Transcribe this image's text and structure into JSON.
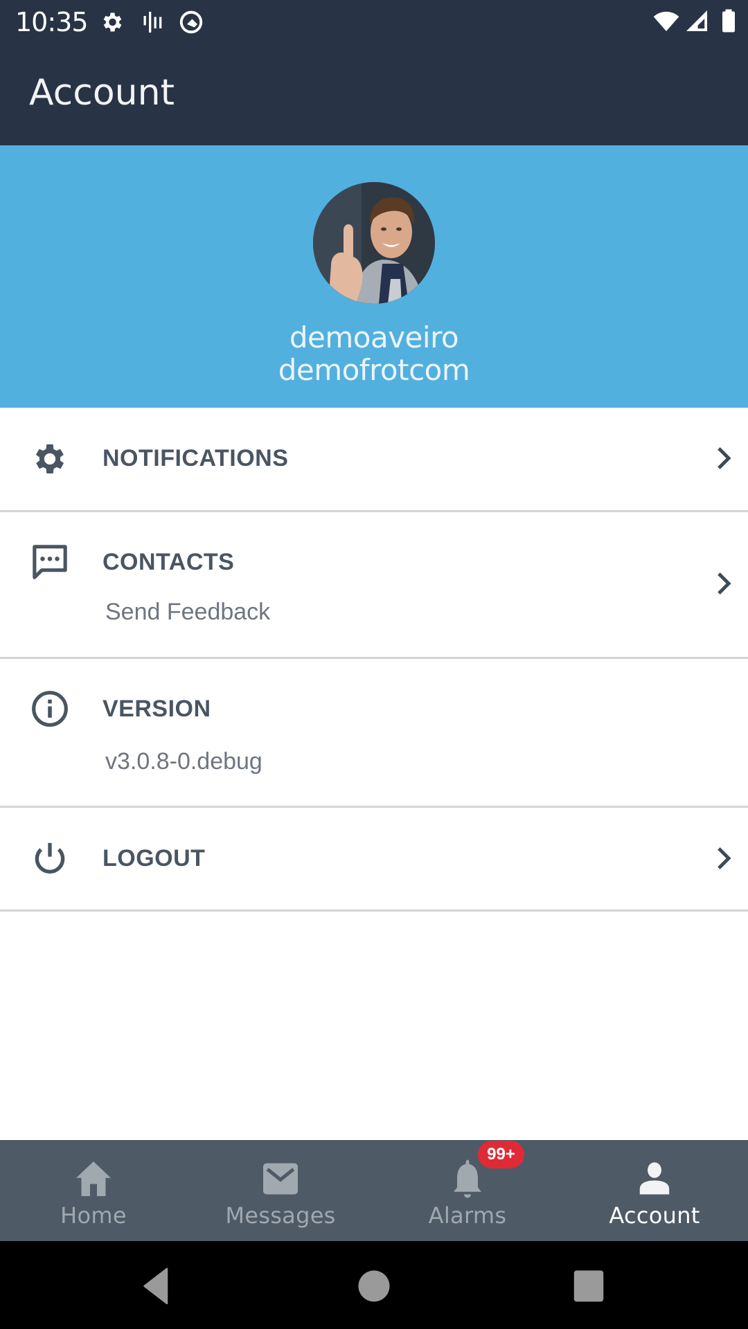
{
  "status_bar": {
    "time": "10:35",
    "left_icons": [
      "settings-icon",
      "signal-bars-icon",
      "q-logo-icon"
    ],
    "right_icons": [
      "wifi-icon",
      "cell-signal-icon",
      "battery-icon"
    ]
  },
  "app_bar": {
    "title": "Account"
  },
  "profile": {
    "avatar": "user-photo",
    "username": "demoaveiro",
    "company": "demofrotcom",
    "background_color": "#52B0DF"
  },
  "menu": {
    "items": [
      {
        "title": "NOTIFICATIONS",
        "subtitle": null,
        "icon": "gear-icon",
        "has_chevron": true
      },
      {
        "title": "CONTACTS",
        "subtitle": "Send Feedback",
        "icon": "chat-bubble-icon",
        "has_chevron": true
      },
      {
        "title": "VERSION",
        "subtitle": "v3.0.8-0.debug",
        "icon": "info-icon",
        "has_chevron": false
      },
      {
        "title": "LOGOUT",
        "subtitle": null,
        "icon": "power-icon",
        "has_chevron": true
      }
    ]
  },
  "bottom_nav": {
    "items": [
      {
        "label": "Home",
        "icon": "home-icon",
        "active": false
      },
      {
        "label": "Messages",
        "icon": "envelope-icon",
        "active": false
      },
      {
        "label": "Alarms",
        "icon": "bell-icon",
        "active": false,
        "badge": "99+"
      },
      {
        "label": "Account",
        "icon": "person-icon",
        "active": true
      }
    ],
    "badge_color": "#E02B36"
  },
  "system_nav": {
    "buttons": [
      "back-icon",
      "home-circle-icon",
      "recents-icon"
    ]
  },
  "colors": {
    "header": "#283445",
    "nav_bar": "#4E5A66",
    "text_primary": "#4A5562",
    "text_secondary": "#6E7580"
  }
}
